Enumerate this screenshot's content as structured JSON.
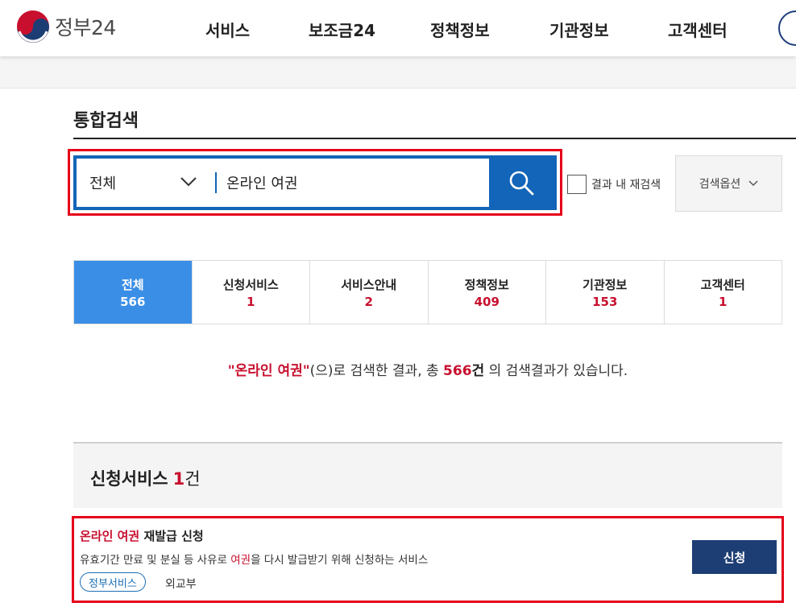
{
  "header": {
    "logo_text": "정부24",
    "nav": [
      "서비스",
      "보조금24",
      "정책정보",
      "기관정보",
      "고객센터"
    ]
  },
  "page_title": "통합검색",
  "search": {
    "category": "전체",
    "query": "온라인 여권",
    "rescan_label": "결과 내 재검색",
    "options_label": "검색옵션"
  },
  "tabs": [
    {
      "label": "전체",
      "count": "566"
    },
    {
      "label": "신청서비스",
      "count": "1"
    },
    {
      "label": "서비스안내",
      "count": "2"
    },
    {
      "label": "정책정보",
      "count": "409"
    },
    {
      "label": "기관정보",
      "count": "153"
    },
    {
      "label": "고객센터",
      "count": "1"
    }
  ],
  "summary": {
    "query_quoted": "\"온라인 여권\"",
    "text_mid": "(으)로 검색한 결과, 총 ",
    "total": "566",
    "unit": "건",
    "text_end": " 의 검색결과가 있습니다."
  },
  "section": {
    "title": "신청서비스",
    "count": "1",
    "unit": "건"
  },
  "result": {
    "title_highlight": "온라인 여권",
    "title_rest": " 재발급 신청",
    "desc_before": "유효기간 만료 및 분실 등 사유로 ",
    "desc_highlight": "여권",
    "desc_after": "을 다시 발급받기 위해 신청하는 서비스",
    "tag": "정부서비스",
    "org": "외교부",
    "apply_label": "신청"
  },
  "colors": {
    "accent_blue": "#1265b8",
    "active_tab": "#3a8ee6",
    "highlight_red": "#c8102e",
    "button_navy": "#1d3e74"
  }
}
